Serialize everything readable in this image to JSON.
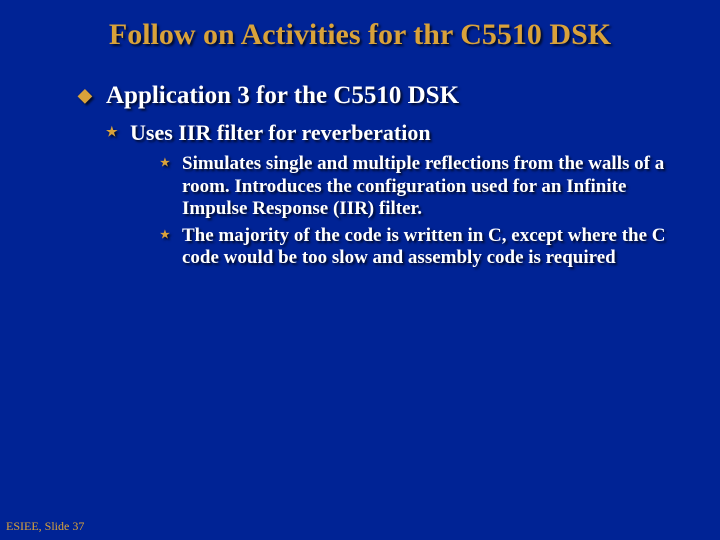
{
  "title": "Follow on Activities for thr C5510 DSK",
  "l1": {
    "text": "Application 3 for the C5510 DSK"
  },
  "l2": {
    "text": "Uses IIR filter for reverberation"
  },
  "l3a": {
    "text": "Simulates single and multiple reflections from the walls of a room. Introduces the configuration used for an Infinite Impulse Response (IIR) filter."
  },
  "l3b": {
    "text": "The majority of the code is written in C, except where the C code would be too slow and assembly code is required"
  },
  "footer": "ESIEE, Slide 37"
}
